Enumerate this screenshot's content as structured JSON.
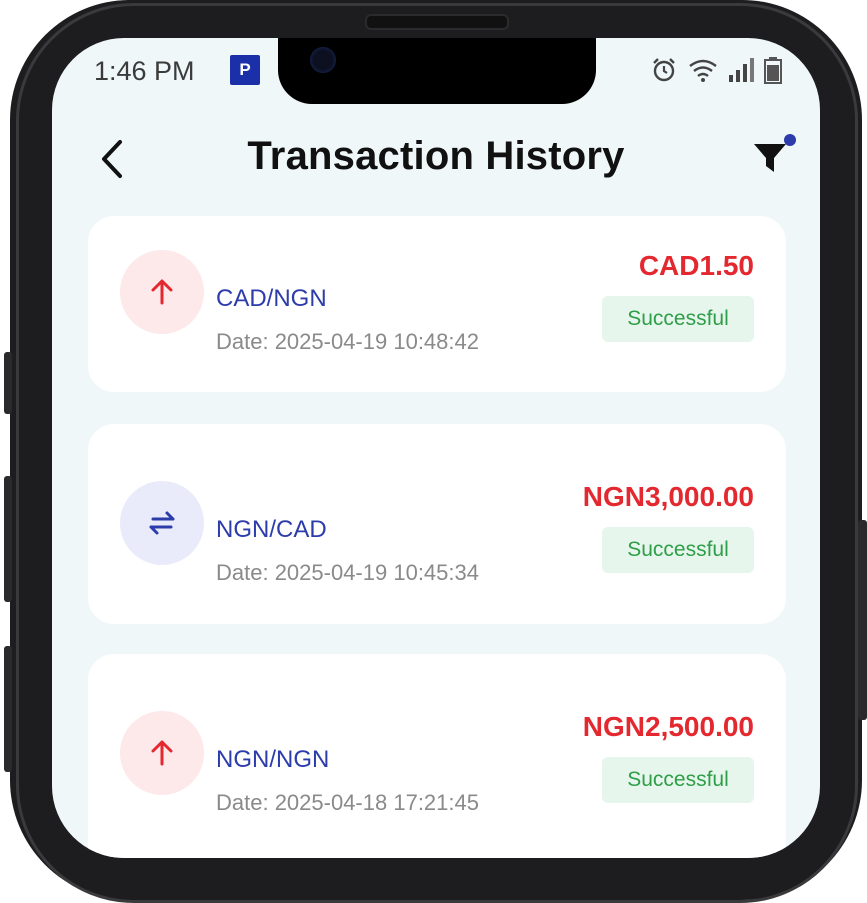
{
  "status_bar": {
    "time": "1:46 PM",
    "app_badge": "P",
    "icons": [
      "alarm-icon",
      "wifi-icon",
      "signal-icon",
      "battery-icon"
    ]
  },
  "header": {
    "title": "Transaction History",
    "back_icon": "chevron-left-icon",
    "filter_icon": "filter-icon",
    "filter_indicator_color": "#2d3cab"
  },
  "transactions": [
    {
      "icon": "arrow-up-icon",
      "pair": "CAD/NGN",
      "date": "Date: 2025-04-19 10:48:42",
      "amount": "CAD1.50",
      "status": "Successful"
    },
    {
      "icon": "swap-arrows-icon",
      "pair": "NGN/CAD",
      "date": "Date: 2025-04-19 10:45:34",
      "amount": "NGN3,000.00",
      "status": "Successful"
    },
    {
      "icon": "arrow-up-icon",
      "pair": "NGN/NGN",
      "date": "Date: 2025-04-18 17:21:45",
      "amount": "NGN2,500.00",
      "status": "Successful"
    }
  ],
  "colors": {
    "amount": "#e4282f",
    "pair_text": "#2d3cab",
    "success_text": "#2f9e48",
    "success_bg": "#e6f6ec",
    "screen_bg": "#eff7f8"
  }
}
